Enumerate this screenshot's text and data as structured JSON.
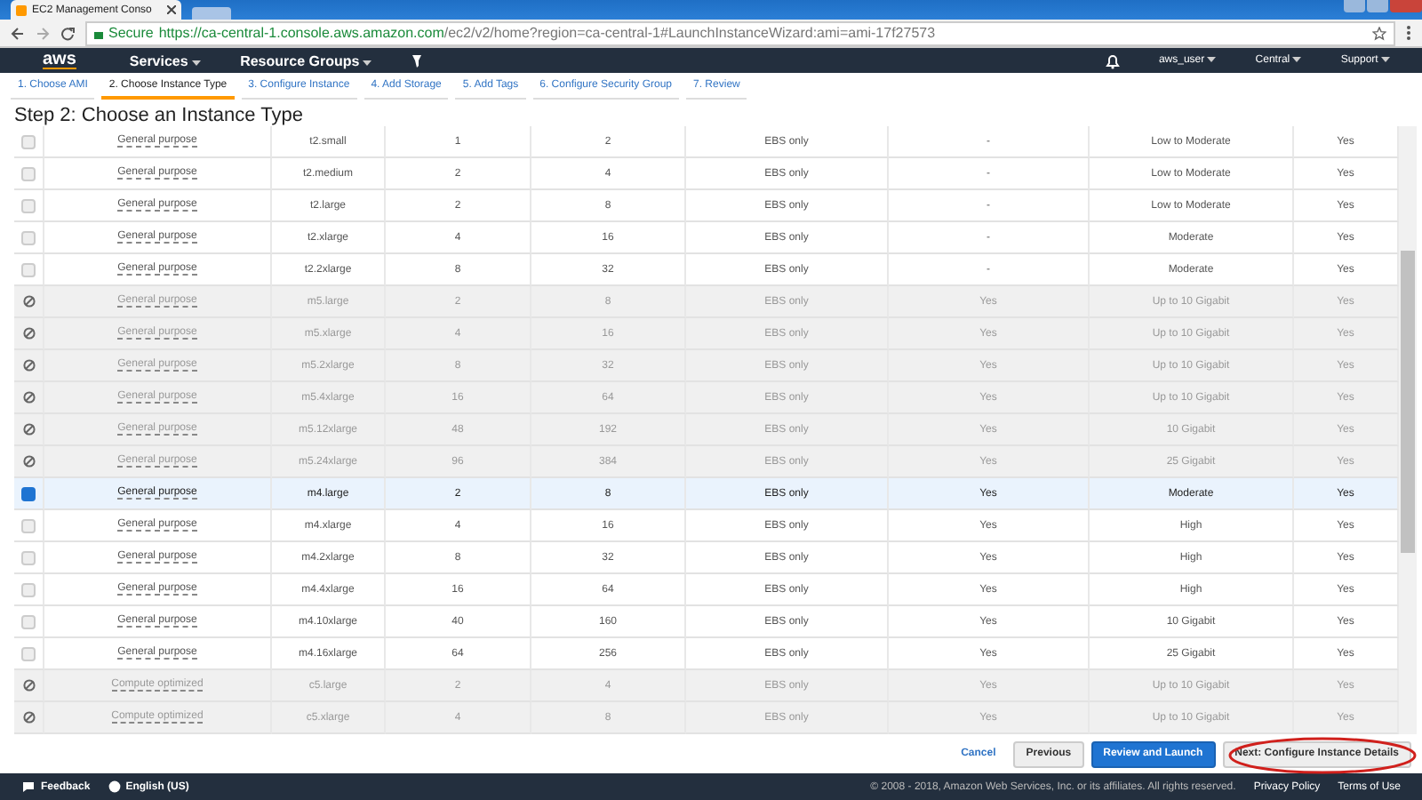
{
  "browser": {
    "tab_title": "EC2 Management Conso",
    "secure_label": "Secure",
    "url_host": "https://ca-central-1.console.aws.amazon.com",
    "url_path": "/ec2/v2/home?region=ca-central-1#LaunchInstanceWizard:ami=ami-17f27573"
  },
  "nav": {
    "logo": "aws",
    "menus": [
      "Services",
      "Resource Groups"
    ],
    "right_menus": [
      "aws_user",
      "Central",
      "Support"
    ]
  },
  "wizard_tabs": [
    {
      "label": "1. Choose AMI",
      "selected": false
    },
    {
      "label": "2. Choose Instance Type",
      "selected": true
    },
    {
      "label": "3. Configure Instance",
      "selected": false
    },
    {
      "label": "4. Add Storage",
      "selected": false
    },
    {
      "label": "5. Add Tags",
      "selected": false
    },
    {
      "label": "6. Configure Security Group",
      "selected": false
    },
    {
      "label": "7. Review",
      "selected": false
    }
  ],
  "title": "Step 2: Choose an Instance Type",
  "rows": [
    {
      "family": "General purpose",
      "type": "t2.small",
      "vcpus": "1",
      "memory": "2",
      "storage": "EBS only",
      "ebs_optimized": "-",
      "network": "Low to Moderate",
      "ipv6": "Yes",
      "disabled": false,
      "selected": false
    },
    {
      "family": "General purpose",
      "type": "t2.medium",
      "vcpus": "2",
      "memory": "4",
      "storage": "EBS only",
      "ebs_optimized": "-",
      "network": "Low to Moderate",
      "ipv6": "Yes",
      "disabled": false,
      "selected": false
    },
    {
      "family": "General purpose",
      "type": "t2.large",
      "vcpus": "2",
      "memory": "8",
      "storage": "EBS only",
      "ebs_optimized": "-",
      "network": "Low to Moderate",
      "ipv6": "Yes",
      "disabled": false,
      "selected": false
    },
    {
      "family": "General purpose",
      "type": "t2.xlarge",
      "vcpus": "4",
      "memory": "16",
      "storage": "EBS only",
      "ebs_optimized": "-",
      "network": "Moderate",
      "ipv6": "Yes",
      "disabled": false,
      "selected": false
    },
    {
      "family": "General purpose",
      "type": "t2.2xlarge",
      "vcpus": "8",
      "memory": "32",
      "storage": "EBS only",
      "ebs_optimized": "-",
      "network": "Moderate",
      "ipv6": "Yes",
      "disabled": false,
      "selected": false
    },
    {
      "family": "General purpose",
      "type": "m5.large",
      "vcpus": "2",
      "memory": "8",
      "storage": "EBS only",
      "ebs_optimized": "Yes",
      "network": "Up to 10 Gigabit",
      "ipv6": "Yes",
      "disabled": true
    },
    {
      "family": "General purpose",
      "type": "m5.xlarge",
      "vcpus": "4",
      "memory": "16",
      "storage": "EBS only",
      "ebs_optimized": "Yes",
      "network": "Up to 10 Gigabit",
      "ipv6": "Yes",
      "disabled": true
    },
    {
      "family": "General purpose",
      "type": "m5.2xlarge",
      "vcpus": "8",
      "memory": "32",
      "storage": "EBS only",
      "ebs_optimized": "Yes",
      "network": "Up to 10 Gigabit",
      "ipv6": "Yes",
      "disabled": true
    },
    {
      "family": "General purpose",
      "type": "m5.4xlarge",
      "vcpus": "16",
      "memory": "64",
      "storage": "EBS only",
      "ebs_optimized": "Yes",
      "network": "Up to 10 Gigabit",
      "ipv6": "Yes",
      "disabled": true
    },
    {
      "family": "General purpose",
      "type": "m5.12xlarge",
      "vcpus": "48",
      "memory": "192",
      "storage": "EBS only",
      "ebs_optimized": "Yes",
      "network": "10 Gigabit",
      "ipv6": "Yes",
      "disabled": true
    },
    {
      "family": "General purpose",
      "type": "m5.24xlarge",
      "vcpus": "96",
      "memory": "384",
      "storage": "EBS only",
      "ebs_optimized": "Yes",
      "network": "25 Gigabit",
      "ipv6": "Yes",
      "disabled": true
    },
    {
      "family": "General purpose",
      "type": "m4.large",
      "vcpus": "2",
      "memory": "8",
      "storage": "EBS only",
      "ebs_optimized": "Yes",
      "network": "Moderate",
      "ipv6": "Yes",
      "disabled": false,
      "selected": true
    },
    {
      "family": "General purpose",
      "type": "m4.xlarge",
      "vcpus": "4",
      "memory": "16",
      "storage": "EBS only",
      "ebs_optimized": "Yes",
      "network": "High",
      "ipv6": "Yes",
      "disabled": false,
      "selected": false
    },
    {
      "family": "General purpose",
      "type": "m4.2xlarge",
      "vcpus": "8",
      "memory": "32",
      "storage": "EBS only",
      "ebs_optimized": "Yes",
      "network": "High",
      "ipv6": "Yes",
      "disabled": false,
      "selected": false
    },
    {
      "family": "General purpose",
      "type": "m4.4xlarge",
      "vcpus": "16",
      "memory": "64",
      "storage": "EBS only",
      "ebs_optimized": "Yes",
      "network": "High",
      "ipv6": "Yes",
      "disabled": false,
      "selected": false
    },
    {
      "family": "General purpose",
      "type": "m4.10xlarge",
      "vcpus": "40",
      "memory": "160",
      "storage": "EBS only",
      "ebs_optimized": "Yes",
      "network": "10 Gigabit",
      "ipv6": "Yes",
      "disabled": false,
      "selected": false
    },
    {
      "family": "General purpose",
      "type": "m4.16xlarge",
      "vcpus": "64",
      "memory": "256",
      "storage": "EBS only",
      "ebs_optimized": "Yes",
      "network": "25 Gigabit",
      "ipv6": "Yes",
      "disabled": false,
      "selected": false
    },
    {
      "family": "Compute optimized",
      "type": "c5.large",
      "vcpus": "2",
      "memory": "4",
      "storage": "EBS only",
      "ebs_optimized": "Yes",
      "network": "Up to 10 Gigabit",
      "ipv6": "Yes",
      "disabled": true
    },
    {
      "family": "Compute optimized",
      "type": "c5.xlarge",
      "vcpus": "4",
      "memory": "8",
      "storage": "EBS only",
      "ebs_optimized": "Yes",
      "network": "Up to 10 Gigabit",
      "ipv6": "Yes",
      "disabled": true
    }
  ],
  "buttons": [
    {
      "label": "Cancel",
      "kind": "link"
    },
    {
      "label": "Previous",
      "kind": "secondary"
    },
    {
      "label": "Review and Launch",
      "kind": "primary"
    },
    {
      "label": "Next: Configure Instance Details",
      "kind": "secondary"
    }
  ],
  "footer": {
    "left": [
      "Feedback",
      "English (US)"
    ],
    "copyright": "© 2008 - 2018, Amazon Web Services, Inc. or its affiliates. All rights reserved.",
    "links": [
      "Privacy Policy",
      "Terms of Use"
    ]
  }
}
